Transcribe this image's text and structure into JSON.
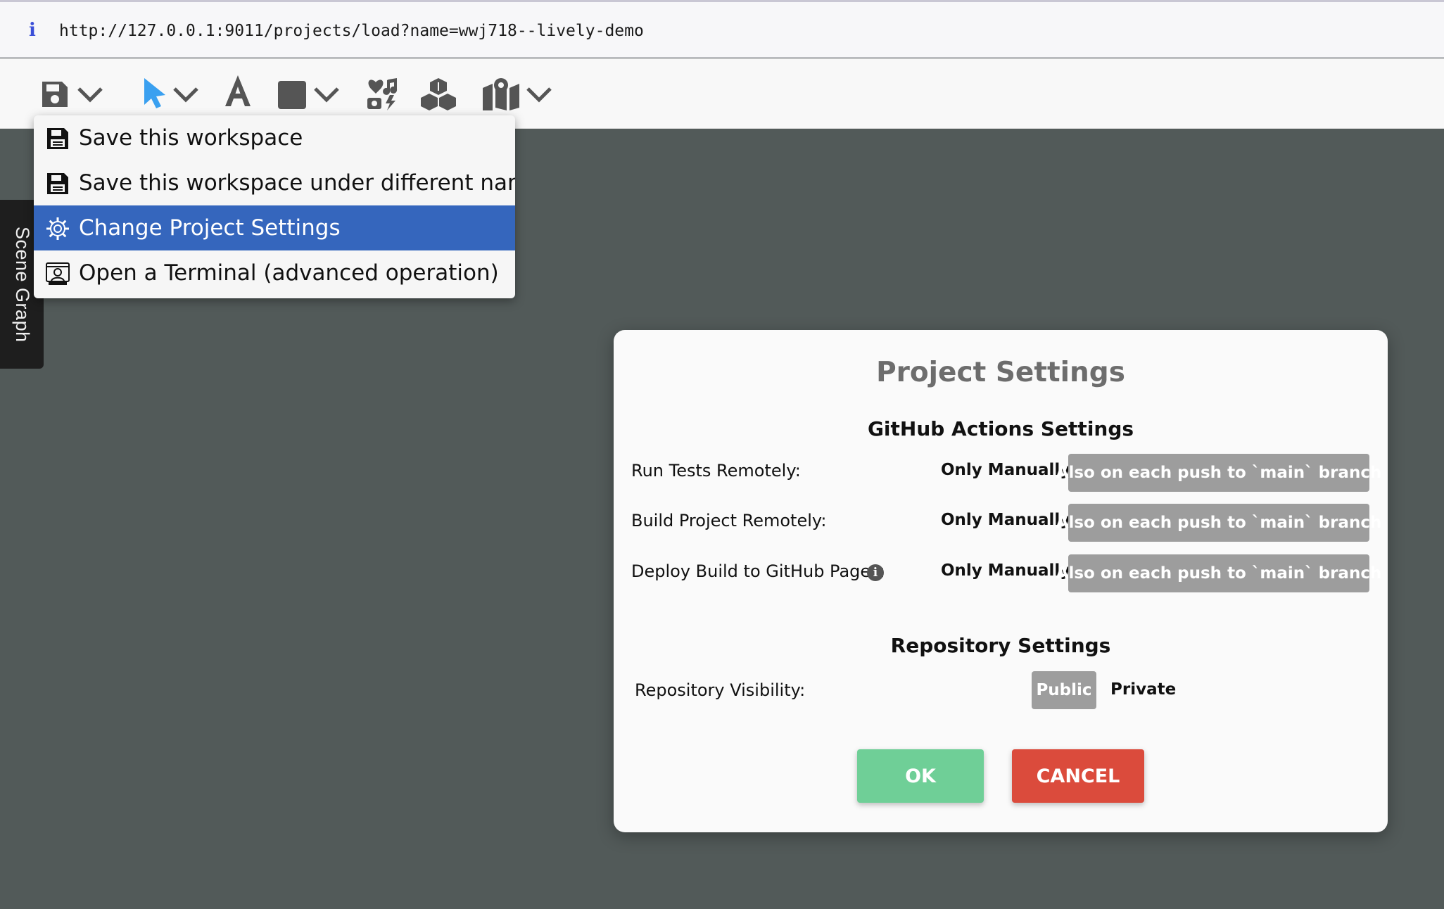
{
  "browser": {
    "url": "http://127.0.0.1:9011/projects/load?name=wwj718--lively-demo",
    "info_icon": "i"
  },
  "toolbar": {
    "icons": [
      "save-icon",
      "chevron-down-icon",
      "pointer-icon",
      "chevron-down-icon",
      "text-icon",
      "shape-icon",
      "chevron-down-icon",
      "media-icon",
      "components-icon",
      "map-icon",
      "chevron-down-icon"
    ],
    "text_tool_glyph": "A"
  },
  "scene_graph": {
    "label": "Scene Graph"
  },
  "menu": {
    "items": [
      {
        "label": "Save this workspace",
        "icon": "floppy-disk-icon",
        "selected": false
      },
      {
        "label": "Save this workspace under different name",
        "icon": "floppy-disk-icon",
        "selected": false
      },
      {
        "label": "Change Project Settings",
        "icon": "gear-icon",
        "selected": true
      },
      {
        "label": "Open a Terminal (advanced operation)",
        "icon": "terminal-icon",
        "selected": false
      }
    ]
  },
  "dialog": {
    "title": "Project Settings",
    "github_heading": "GitHub Actions Settings",
    "rows": [
      {
        "label": "Run Tests Remotely:",
        "option_manual": "Only Manually",
        "option_push": "Also on each push to `main` branch"
      },
      {
        "label": "Build Project Remotely:",
        "option_manual": "Only Manually",
        "option_push": "Also on each push to `main` branch"
      },
      {
        "label": "Deploy Build to GitHub Pages:",
        "option_manual": "Only Manually",
        "option_push": "Also on each push to `main` branch",
        "info_icon": "i"
      }
    ],
    "repo_heading": "Repository Settings",
    "visibility": {
      "label": "Repository Visibility:",
      "option_public": "Public",
      "option_private": "Private"
    },
    "ok_label": "OK",
    "cancel_label": "CANCEL"
  },
  "colors": {
    "canvas": "#525a59",
    "menu_selected": "#3566bd",
    "option_box": "#9d9d9d",
    "ok_button": "#6fcf97",
    "cancel_button": "#db4b3c",
    "pointer_tool": "#3aa0f0"
  }
}
